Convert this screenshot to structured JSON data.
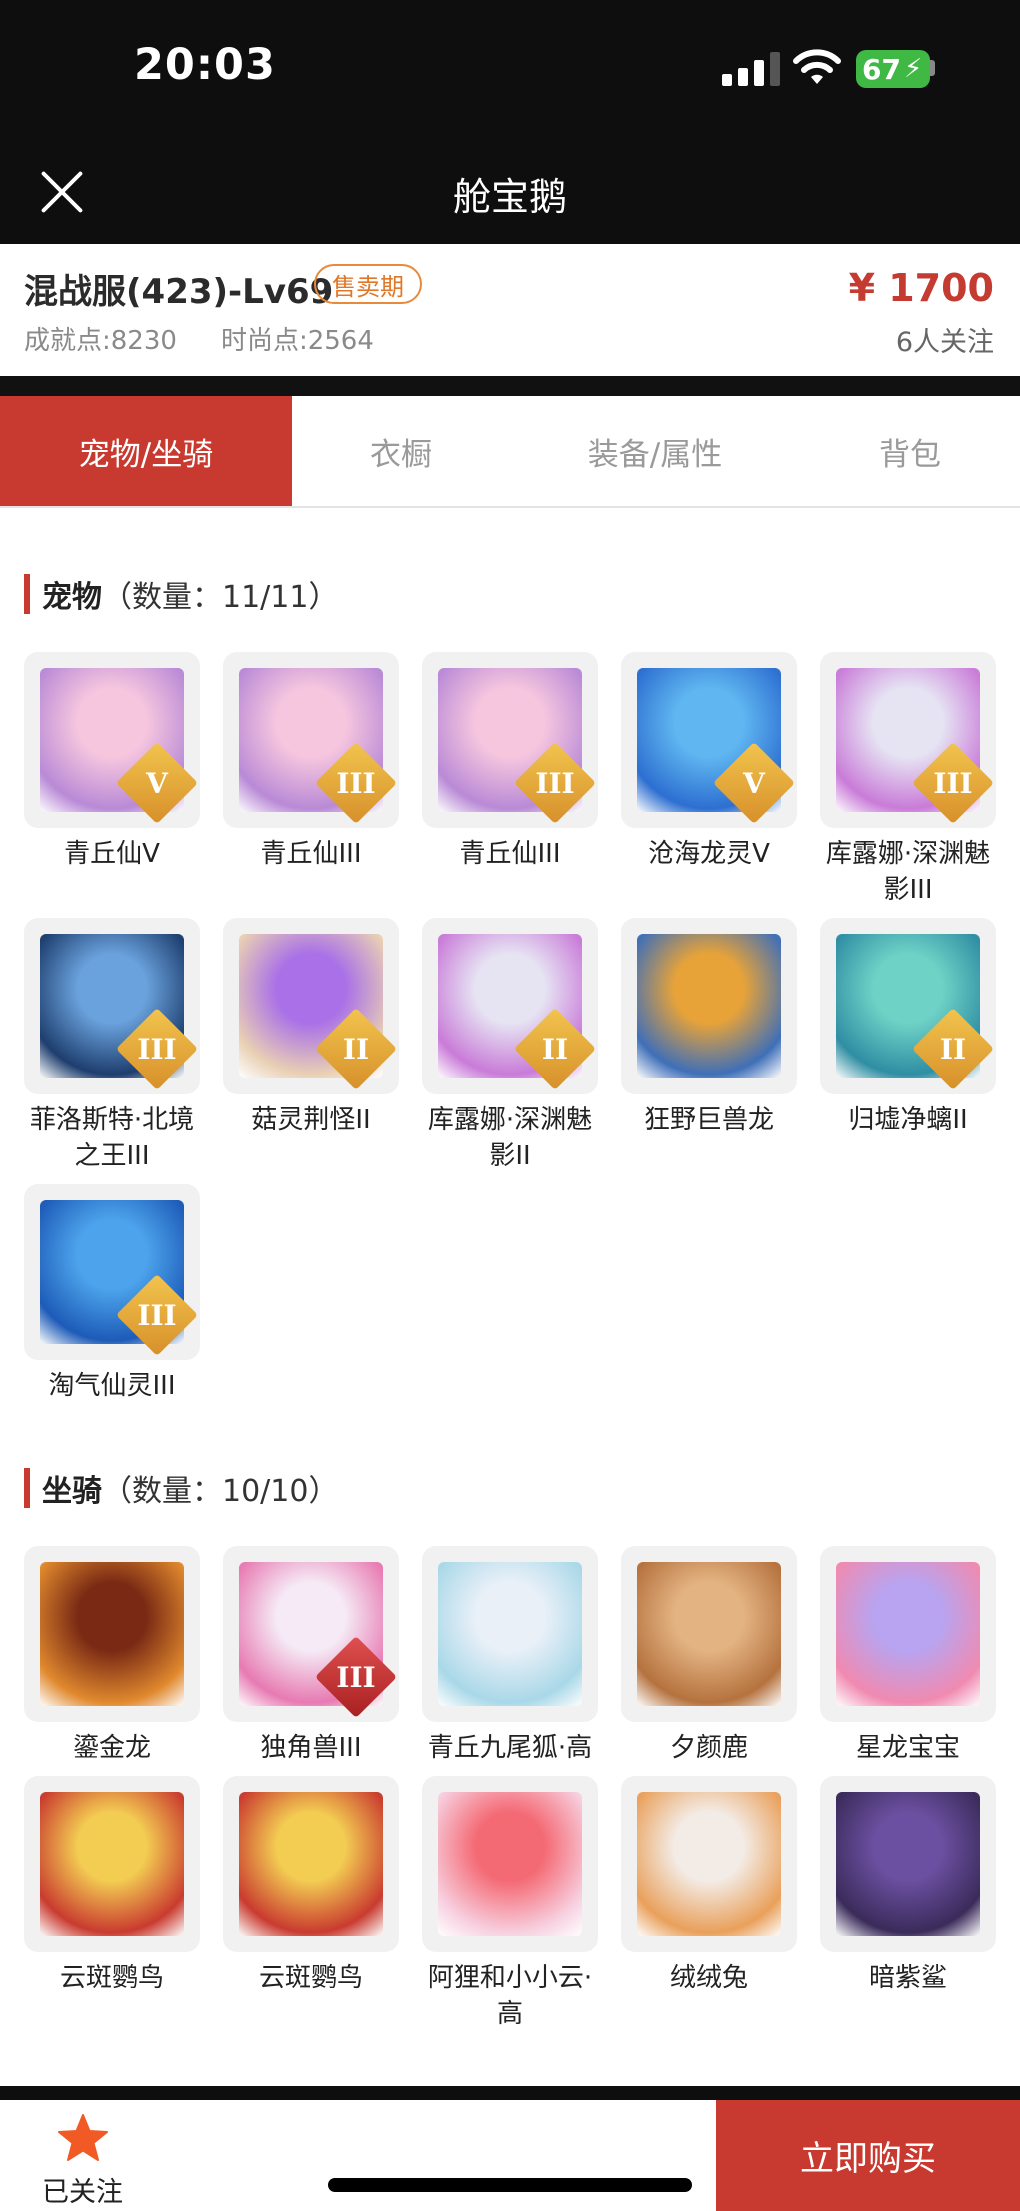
{
  "status_bar": {
    "time": "20:03",
    "battery": "67"
  },
  "nav": {
    "title": "舱宝鹅",
    "close_icon": "close-icon"
  },
  "header": {
    "server": "混战服(423)-Lv69",
    "badge": "售卖期",
    "achievement_label": "成就点:",
    "achievement_value": "8230",
    "fashion_label": "时尚点:",
    "fashion_value": "2564",
    "price": "¥ 1700",
    "followers": "6人关注"
  },
  "tabs": [
    {
      "label": "宠物/坐骑",
      "active": true
    },
    {
      "label": "衣橱",
      "active": false
    },
    {
      "label": "装备/属性",
      "active": false
    },
    {
      "label": "背包",
      "active": false
    }
  ],
  "pets": {
    "title": "宠物",
    "count": "（数量：11/11）",
    "items": [
      {
        "name": "青丘仙V",
        "tier": "V",
        "colors": [
          "#f6c6df",
          "#b98ad6"
        ]
      },
      {
        "name": "青丘仙III",
        "tier": "III",
        "colors": [
          "#f6c6df",
          "#b98ad6"
        ]
      },
      {
        "name": "青丘仙III",
        "tier": "III",
        "colors": [
          "#f6c6df",
          "#b98ad6"
        ]
      },
      {
        "name": "沧海龙灵V",
        "tier": "V",
        "colors": [
          "#5fb6f0",
          "#2d6fd1"
        ]
      },
      {
        "name": "库露娜·深渊魅影III",
        "tier": "III",
        "colors": [
          "#e6e4f3",
          "#c97bd8"
        ]
      },
      {
        "name": "菲洛斯特·北境之王III",
        "tier": "III",
        "colors": [
          "#6aa2dd",
          "#1e3e6e"
        ]
      },
      {
        "name": "菇灵荆怪II",
        "tier": "II",
        "colors": [
          "#a970e8",
          "#e9d0b4"
        ]
      },
      {
        "name": "库露娜·深渊魅影II",
        "tier": "II",
        "colors": [
          "#e6e4f3",
          "#c97bd8"
        ]
      },
      {
        "name": "狂野巨兽龙",
        "tier": "",
        "colors": [
          "#e8a338",
          "#3f6fb8"
        ]
      },
      {
        "name": "归墟净螭II",
        "tier": "II",
        "colors": [
          "#6ed2c6",
          "#2f8ea3"
        ]
      },
      {
        "name": "淘气仙灵III",
        "tier": "III",
        "colors": [
          "#4da4ec",
          "#1d5bb8"
        ]
      }
    ]
  },
  "mounts": {
    "title": "坐骑",
    "count": "（数量：10/10）",
    "items": [
      {
        "name": "鎏金龙",
        "tier": "",
        "colors": [
          "#7a2a14",
          "#e0892e"
        ]
      },
      {
        "name": "独角兽III",
        "tier": "III",
        "colors": [
          "#f5eaf5",
          "#e77ab2"
        ]
      },
      {
        "name": "青丘九尾狐·高",
        "tier": "",
        "colors": [
          "#e9f0f8",
          "#a9d8e8"
        ]
      },
      {
        "name": "夕颜鹿",
        "tier": "",
        "colors": [
          "#e3b382",
          "#b5723e"
        ]
      },
      {
        "name": "星龙宝宝",
        "tier": "",
        "colors": [
          "#b8a4f0",
          "#f08ab0"
        ]
      },
      {
        "name": "云斑鹦鸟",
        "tier": "",
        "colors": [
          "#f3cc52",
          "#c93b2f"
        ]
      },
      {
        "name": "云斑鹦鸟",
        "tier": "",
        "colors": [
          "#f3cc52",
          "#c93b2f"
        ]
      },
      {
        "name": "阿狸和小小云·高",
        "tier": "",
        "colors": [
          "#f46a74",
          "#f7d0e0"
        ]
      },
      {
        "name": "绒绒兔",
        "tier": "",
        "colors": [
          "#f3ece6",
          "#e9a05b"
        ]
      },
      {
        "name": "暗紫鲨",
        "tier": "",
        "colors": [
          "#6b4fa0",
          "#3a2b5a"
        ]
      }
    ]
  },
  "footer": {
    "follow_label": "已关注",
    "follow_icon": "star-icon",
    "buy_label": "立即购买"
  }
}
